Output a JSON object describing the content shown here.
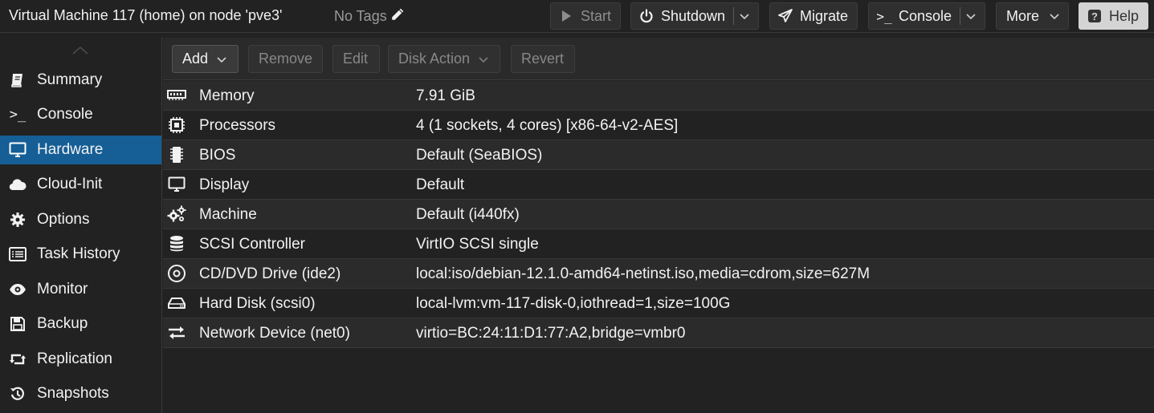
{
  "header": {
    "title": "Virtual Machine 117 (home) on node 'pve3'",
    "tags_label": "No Tags",
    "buttons": {
      "start": "Start",
      "shutdown": "Shutdown",
      "migrate": "Migrate",
      "console": "Console",
      "more": "More",
      "help": "Help"
    }
  },
  "sidebar": {
    "items": [
      {
        "label": "Summary",
        "icon": "book-icon"
      },
      {
        "label": "Console",
        "icon": "terminal-icon"
      },
      {
        "label": "Hardware",
        "icon": "desktop-icon",
        "active": true
      },
      {
        "label": "Cloud-Init",
        "icon": "cloud-icon"
      },
      {
        "label": "Options",
        "icon": "gear-icon"
      },
      {
        "label": "Task History",
        "icon": "list-icon"
      },
      {
        "label": "Monitor",
        "icon": "eye-icon"
      },
      {
        "label": "Backup",
        "icon": "floppy-icon"
      },
      {
        "label": "Replication",
        "icon": "retweet-icon"
      },
      {
        "label": "Snapshots",
        "icon": "history-icon"
      }
    ]
  },
  "toolbar": {
    "add": "Add",
    "remove": "Remove",
    "edit": "Edit",
    "disk_action": "Disk Action",
    "revert": "Revert"
  },
  "hardware": [
    {
      "name": "Memory",
      "value": "7.91 GiB",
      "icon": "memory-icon"
    },
    {
      "name": "Processors",
      "value": "4 (1 sockets, 4 cores) [x86-64-v2-AES]",
      "icon": "cpu-icon"
    },
    {
      "name": "BIOS",
      "value": "Default (SeaBIOS)",
      "icon": "microchip-icon"
    },
    {
      "name": "Display",
      "value": "Default",
      "icon": "desktop-icon"
    },
    {
      "name": "Machine",
      "value": "Default (i440fx)",
      "icon": "cogs-icon"
    },
    {
      "name": "SCSI Controller",
      "value": "VirtIO SCSI single",
      "icon": "database-icon"
    },
    {
      "name": "CD/DVD Drive (ide2)",
      "value": "local:iso/debian-12.1.0-amd64-netinst.iso,media=cdrom,size=627M",
      "icon": "cdrom-icon"
    },
    {
      "name": "Hard Disk (scsi0)",
      "value": "local-lvm:vm-117-disk-0,iothread=1,size=100G",
      "icon": "hdd-icon"
    },
    {
      "name": "Network Device (net0)",
      "value": "virtio=BC:24:11:D1:77:A2,bridge=vmbr0",
      "icon": "exchange-icon"
    }
  ],
  "colors": {
    "background": "#222222",
    "accent_selected": "#155e96",
    "row_alt": "#2b2b2b"
  }
}
